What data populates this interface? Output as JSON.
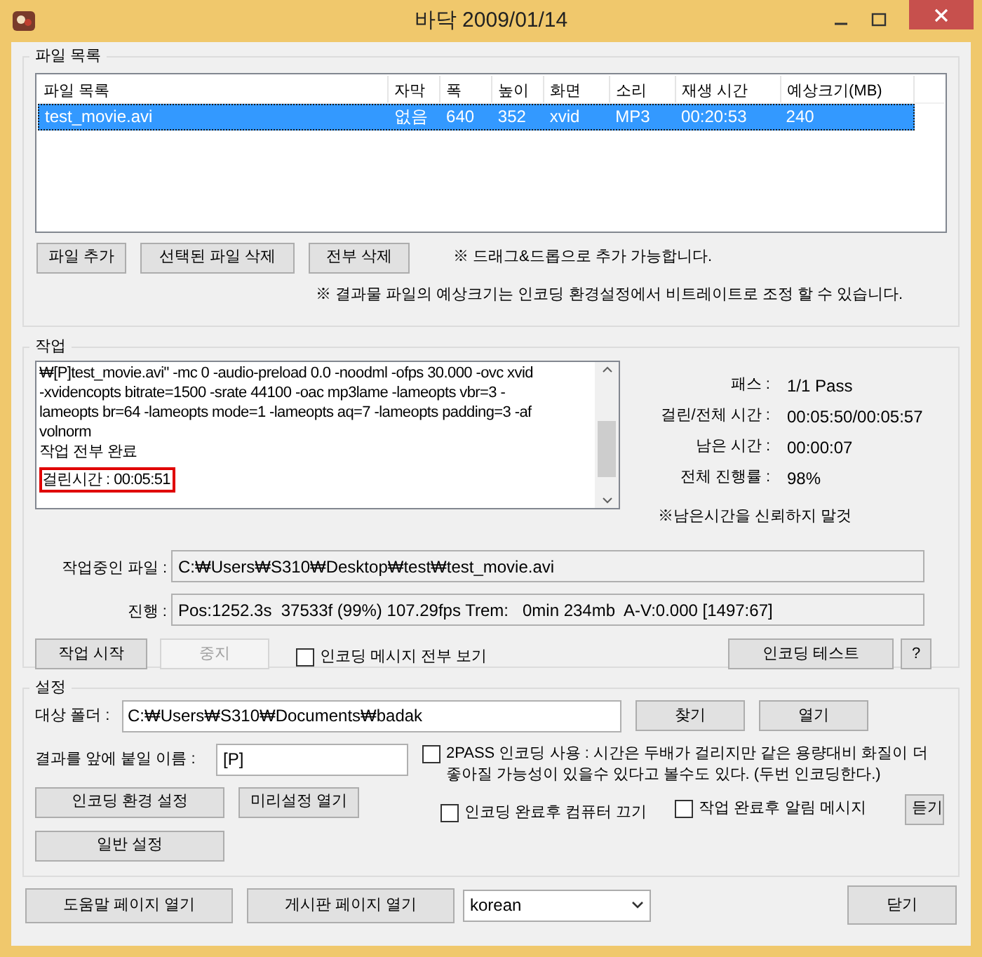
{
  "window": {
    "title": "바닥 2009/01/14"
  },
  "file_list": {
    "title": "파일 목록",
    "columns": [
      "파일 목록",
      "자막",
      "폭",
      "높이",
      "화면",
      "소리",
      "재생 시간",
      "예상크기(MB)"
    ],
    "rows": [
      {
        "cells": [
          "test_movie.avi",
          "없음",
          "640",
          "352",
          "xvid",
          "MP3",
          "00:20:53",
          "240"
        ],
        "selected": true
      }
    ],
    "buttons": [
      "파일 추가",
      "선택된 파일 삭제",
      "전부 삭제"
    ],
    "notes": [
      "※ 드래그&드롭으로 추가 가능합니다.",
      "※ 결과물 파일의 예상크기는 인코딩 환경설정에서 비트레이트로 조정 할 수 있습니다."
    ]
  },
  "job": {
    "title": "작업",
    "log_lines": [
      {
        "text": "₩[P]test_movie.avi\" -mc 0 -audio-preload 0.0 -noodml -ofps 30.000 -ovc xvid",
        "highlighted": false
      },
      {
        "text": "-xvidencopts bitrate=1500 -srate 44100 -oac mp3lame -lameopts vbr=3  -",
        "highlighted": false
      },
      {
        "text": "lameopts br=64 -lameopts mode=1 -lameopts aq=7 -lameopts padding=3 -af",
        "highlighted": false
      },
      {
        "text": "volnorm",
        "highlighted": false
      },
      {
        "text": "작업 전부 완료",
        "highlighted": false
      },
      {
        "text": "걸린시간 : 00:05:51",
        "highlighted": true
      }
    ],
    "stats": [
      {
        "label": "패스 :",
        "value": "1/1 Pass"
      },
      {
        "label": "걸린/전체 시간 :",
        "value": "00:05:50/00:05:57"
      },
      {
        "label": "남은 시간 :",
        "value": "00:00:07"
      },
      {
        "label": "전체 진행률 :",
        "value": "98%"
      }
    ],
    "stats_note": "※남은시간을 신뢰하지 말것",
    "fields": [
      {
        "label": "작업중인 파일 :",
        "value": "C:₩Users₩S310₩Desktop₩test₩test_movie.avi"
      },
      {
        "label": "진행 :",
        "value": "Pos:1252.3s  37533f (99%) 107.29fps Trem:   0min 234mb  A-V:0.000 [1497:67]"
      }
    ],
    "start_button": {
      "label": "작업 시작",
      "disabled": false
    },
    "stop_button": {
      "label": "중지",
      "disabled": true
    },
    "show_all_messages": {
      "label": "인코딩 메시지 전부 보기",
      "checked": false
    },
    "test_button": "인코딩 테스트",
    "help_button": "?"
  },
  "settings": {
    "title": "설정",
    "target_folder": {
      "label": "대상 폴더 :",
      "value": "C:₩Users₩S310₩Documents₩badak"
    },
    "find_button": "찾기",
    "open_button": "열기",
    "prefix": {
      "label": "결과를 앞에 붙일 이름 :",
      "value": "[P]"
    },
    "two_pass": {
      "label": "2PASS 인코딩 사용 : 시간은 두배가 걸리지만 같은 용량대비 화질이 더 좋아질 가능성이 있을수 있다고 볼수도 있다. (두번 인코딩한다.)",
      "checked": false
    },
    "encoding_settings_button": "인코딩 환경 설정",
    "preset_button": "미리설정 열기",
    "general_button": "일반 설정",
    "shutdown": {
      "label": "인코딩 완료후 컴퓨터 끄기",
      "checked": false
    },
    "notify": {
      "label": "작업 완료후 알림 메시지",
      "checked": false
    },
    "listen_button": "듣기"
  },
  "bottom": {
    "help_button": "도움말 페이지 열기",
    "board_button": "게시판 페이지 열기",
    "language": "korean",
    "close_button": "닫기"
  }
}
